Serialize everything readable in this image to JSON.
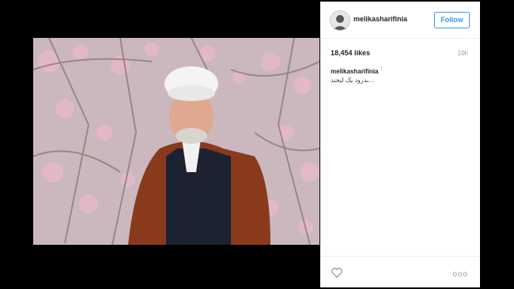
{
  "post": {
    "username": "melikasharifinia",
    "follow_label": "Follow",
    "likes": "18,454 likes",
    "time_ago": "10h",
    "caption_user": "melikasharifinia",
    "caption_mark": "|",
    "caption_text": "بدرود یک لبخند..."
  },
  "actions": {
    "more_label": "ooo"
  },
  "colors": {
    "accent": "#3897f0",
    "text": "#262626",
    "muted": "#999999"
  },
  "icons": [
    "heart-icon",
    "more-options-icon"
  ]
}
